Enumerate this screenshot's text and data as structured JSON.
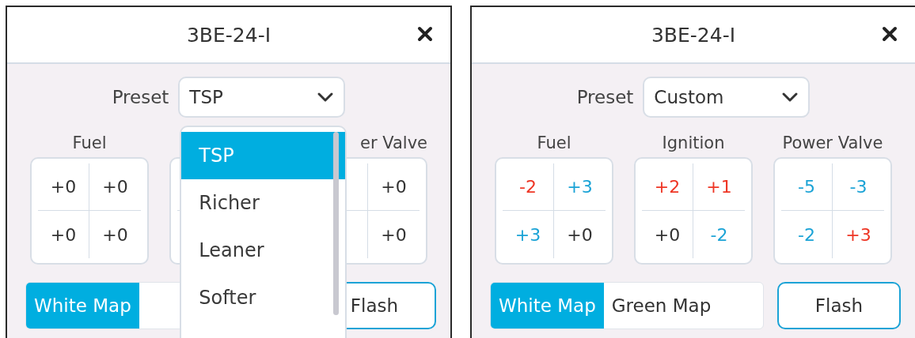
{
  "panels": [
    {
      "title": "3BE-24-I",
      "preset": {
        "label": "Preset",
        "value": "TSP",
        "expanded": true,
        "options": [
          {
            "label": "TSP",
            "selected": true
          },
          {
            "label": "Richer",
            "selected": false
          },
          {
            "label": "Leaner",
            "selected": false
          },
          {
            "label": "Softer",
            "selected": false
          }
        ]
      },
      "groups": [
        {
          "label": "Fuel",
          "cells": [
            {
              "value": "+0",
              "color": "#333333"
            },
            {
              "value": "+0",
              "color": "#333333"
            },
            {
              "value": "+0",
              "color": "#333333"
            },
            {
              "value": "+0",
              "color": "#333333"
            }
          ]
        },
        {
          "cells": [
            null,
            null,
            null,
            null
          ]
        },
        {
          "label": "er Valve",
          "label_cut": true,
          "cells": [
            null,
            {
              "value": "+0",
              "color": "#333333"
            },
            null,
            {
              "value": "+0",
              "color": "#333333"
            }
          ]
        }
      ],
      "map_toggle": [
        {
          "label": "White Map",
          "selected": true
        }
      ],
      "flash": "Flash"
    },
    {
      "title": "3BE-24-I",
      "preset": {
        "label": "Preset",
        "value": "Custom",
        "expanded": false
      },
      "groups": [
        {
          "label": "Fuel",
          "cells": [
            {
              "value": "-2",
              "color": "#ee3524"
            },
            {
              "value": "+3",
              "color": "#1ba3d6"
            },
            {
              "value": "+3",
              "color": "#1ba3d6"
            },
            {
              "value": "+0",
              "color": "#333333"
            }
          ]
        },
        {
          "label": "Ignition",
          "cells": [
            {
              "value": "+2",
              "color": "#ee3524"
            },
            {
              "value": "+1",
              "color": "#ee3524"
            },
            {
              "value": "+0",
              "color": "#333333"
            },
            {
              "value": "-2",
              "color": "#1ba3d6"
            }
          ]
        },
        {
          "label": "Power Valve",
          "cells": [
            {
              "value": "-5",
              "color": "#1ba3d6"
            },
            {
              "value": "-3",
              "color": "#1ba3d6"
            },
            {
              "value": "-2",
              "color": "#1ba3d6"
            },
            {
              "value": "+3",
              "color": "#ee3524"
            }
          ]
        }
      ],
      "map_toggle": [
        {
          "label": "White Map",
          "selected": true
        },
        {
          "label": "Green Map",
          "selected": false
        }
      ],
      "flash": "Flash"
    }
  ]
}
